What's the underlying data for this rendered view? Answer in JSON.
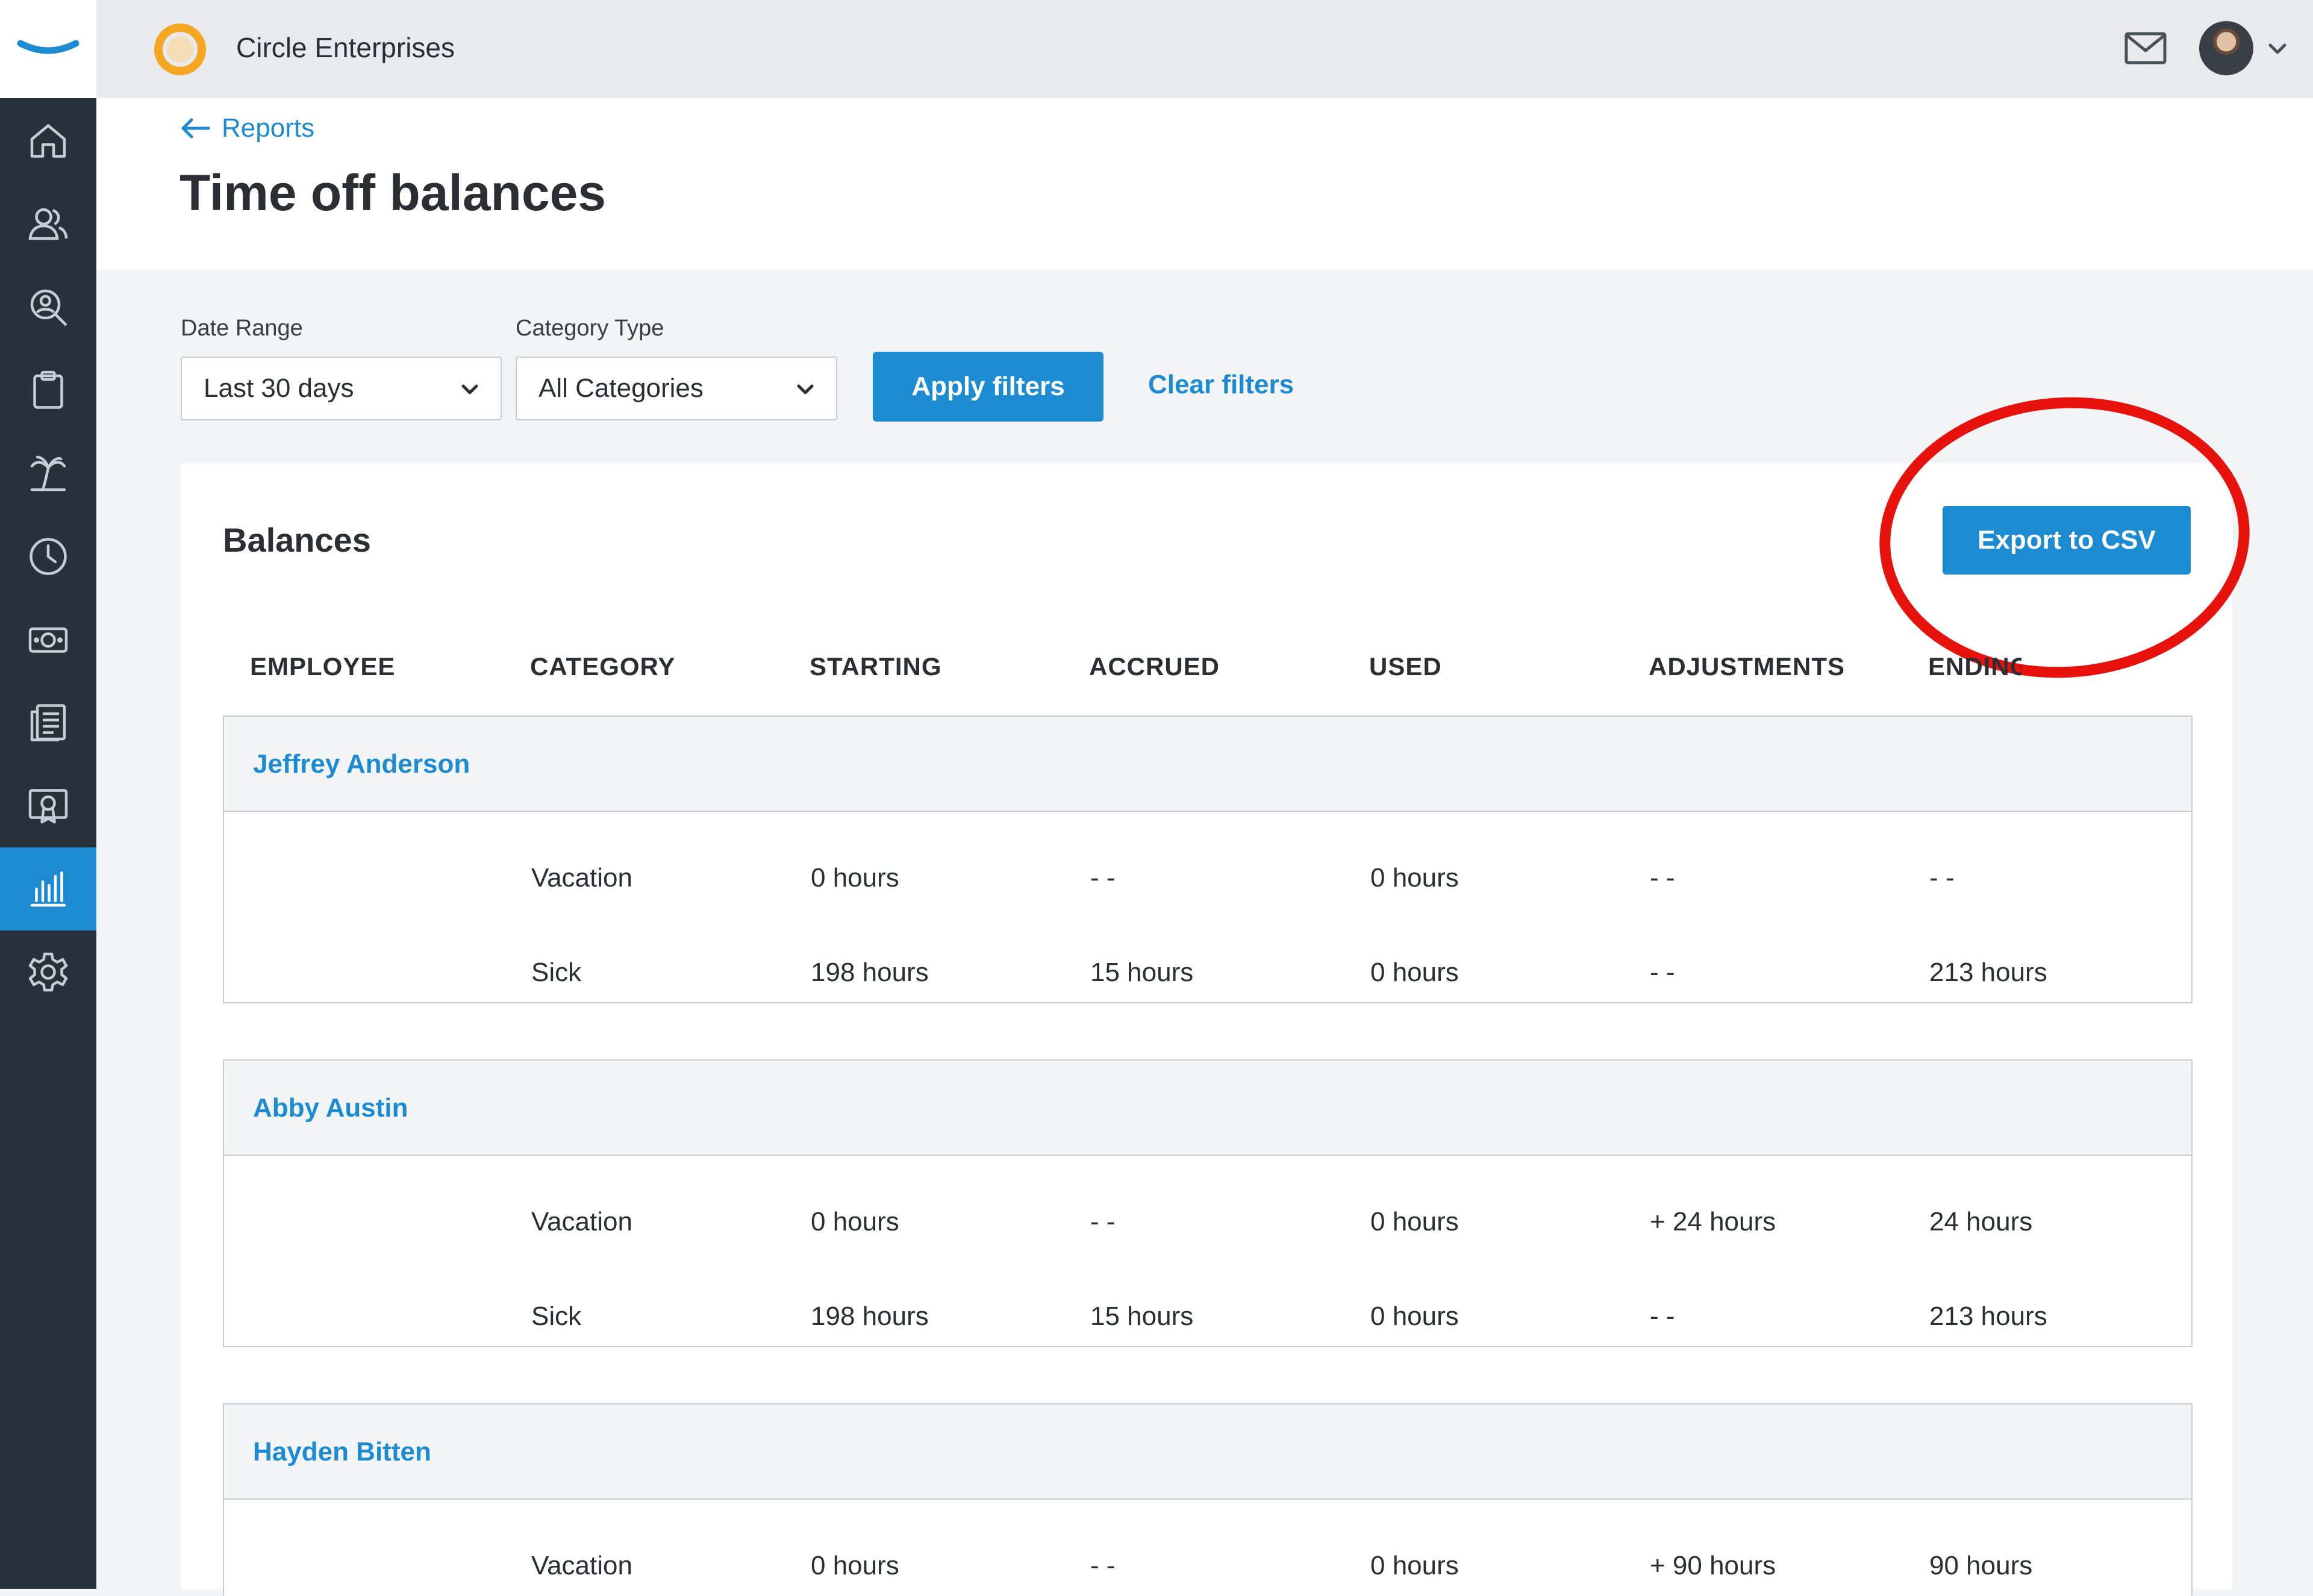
{
  "app": {
    "company_name": "Circle Enterprises"
  },
  "sidebar": {
    "items": [
      {
        "name": "home-icon"
      },
      {
        "name": "people-icon"
      },
      {
        "name": "search-user-icon"
      },
      {
        "name": "clipboard-icon"
      },
      {
        "name": "palm-tree-icon"
      },
      {
        "name": "clock-icon"
      },
      {
        "name": "money-icon"
      },
      {
        "name": "documents-icon"
      },
      {
        "name": "certificate-icon"
      },
      {
        "name": "reports-icon",
        "active": true
      },
      {
        "name": "gear-icon"
      }
    ]
  },
  "header": {
    "back_label": "Reports",
    "title": "Time off balances"
  },
  "filters": {
    "date_range_label": "Date Range",
    "date_range_value": "Last 30 days",
    "category_label": "Category Type",
    "category_value": "All Categories",
    "apply_label": "Apply filters",
    "clear_label": "Clear filters"
  },
  "balances": {
    "title": "Balances",
    "export_label": "Export to CSV",
    "columns": [
      "EMPLOYEE",
      "CATEGORY",
      "STARTING",
      "ACCRUED",
      "USED",
      "ADJUSTMENTS",
      "ENDING"
    ],
    "groups": [
      {
        "employee": "Jeffrey Anderson",
        "rows": [
          {
            "category": "Vacation",
            "starting": "0 hours",
            "accrued": "- -",
            "used": "0 hours",
            "adjustments": "- -",
            "ending": "- -"
          },
          {
            "category": "Sick",
            "starting": "198 hours",
            "accrued": "15 hours",
            "used": "0 hours",
            "adjustments": "- -",
            "ending": "213 hours"
          }
        ]
      },
      {
        "employee": "Abby Austin",
        "rows": [
          {
            "category": "Vacation",
            "starting": "0 hours",
            "accrued": "- -",
            "used": "0 hours",
            "adjustments": "+ 24 hours",
            "ending": "24 hours"
          },
          {
            "category": "Sick",
            "starting": "198 hours",
            "accrued": "15 hours",
            "used": "0 hours",
            "adjustments": "- -",
            "ending": "213 hours"
          }
        ]
      },
      {
        "employee": "Hayden Bitten",
        "rows": [
          {
            "category": "Vacation",
            "starting": "0 hours",
            "accrued": "- -",
            "used": "0 hours",
            "adjustments": "+ 90 hours",
            "ending": "90 hours"
          }
        ]
      }
    ]
  },
  "colors": {
    "accent": "#1d8bd2",
    "sidebar": "#27313b",
    "highlight": "#e8120d"
  }
}
